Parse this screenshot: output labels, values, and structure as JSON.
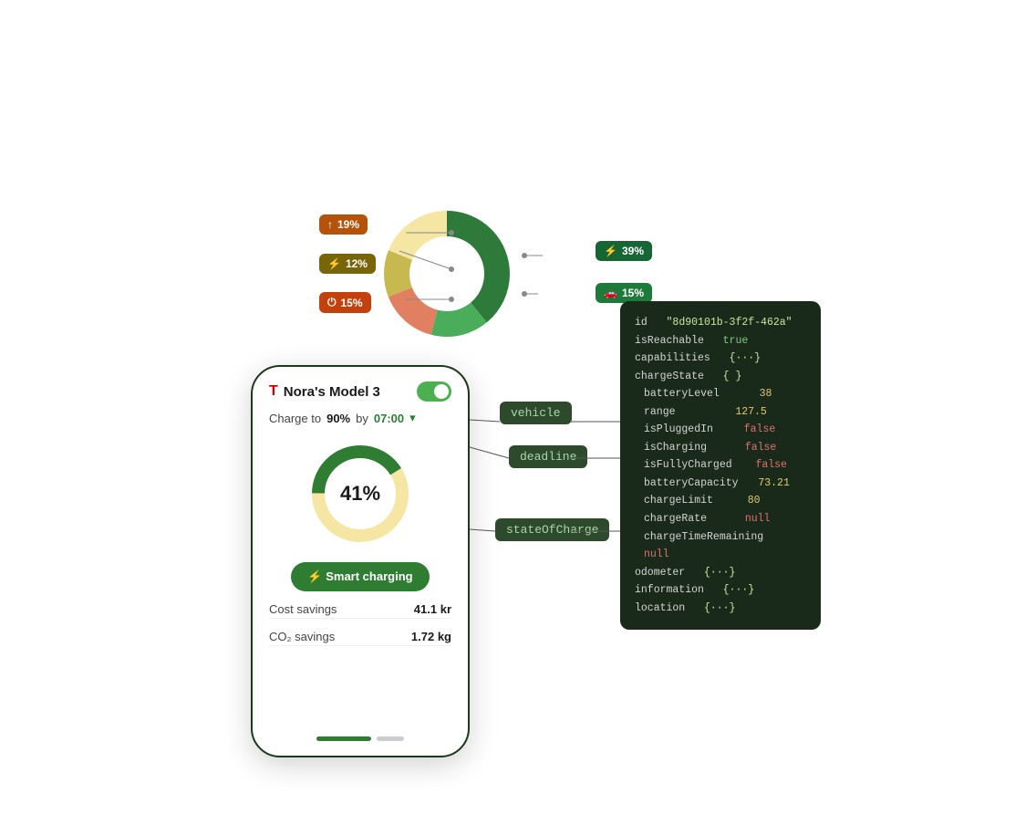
{
  "donut": {
    "segments": [
      {
        "label": "19%",
        "color": "#f5e6a3",
        "value": 19,
        "icon": "↑"
      },
      {
        "label": "12%",
        "color": "#c8b850",
        "value": 12,
        "icon": "⚡"
      },
      {
        "label": "15%",
        "color": "#e8a080",
        "value": 15,
        "icon": "⏻"
      },
      {
        "label": "39%",
        "color": "#2d7a3a",
        "value": 39,
        "icon": "⚡"
      },
      {
        "label": "15%",
        "color": "#4aad5a",
        "value": 15,
        "icon": "🚗"
      }
    ]
  },
  "phone": {
    "title": "Nora's Model 3",
    "charge_to": "Charge to",
    "charge_pct": "90%",
    "charge_by": "by",
    "charge_time": "07:00",
    "battery_pct": "41%",
    "smart_btn": "⚡ Smart charging",
    "cost_label": "Cost savings",
    "cost_val": "41.1 kr",
    "co2_label": "CO₂ savings",
    "co2_val": "1.72 kg"
  },
  "flow": {
    "vehicle_label": "vehicle",
    "deadline_label": "deadline",
    "stateOfCharge_label": "stateOfCharge"
  },
  "json_panel": {
    "id_key": "id",
    "id_val": "\"8d90101b-3f2f-462a\"",
    "isReachable_key": "isReachable",
    "isReachable_val": "true",
    "capabilities_key": "capabilities",
    "capabilities_val": "{···}",
    "chargeState_key": "chargeState",
    "chargeState_val": "{ }",
    "batteryLevel_key": "batteryLevel",
    "batteryLevel_val": "38",
    "range_key": "range",
    "range_val": "127.5",
    "isPluggedIn_key": "isPluggedIn",
    "isPluggedIn_val": "false",
    "isCharging_key": "isCharging",
    "isCharging_val": "false",
    "isFullyCharged_key": "isFullyCharged",
    "isFullyCharged_val": "false",
    "batteryCapacity_key": "batteryCapacity",
    "batteryCapacity_val": "73.21",
    "chargeLimit_key": "chargeLimit",
    "chargeLimit_val": "80",
    "chargeRate_key": "chargeRate",
    "chargeRate_val": "null",
    "chargeTimeRemaining_key": "chargeTimeRemaining",
    "chargeTimeRemaining_val": "null",
    "odometer_key": "odometer",
    "odometer_val": "{···}",
    "information_key": "information",
    "information_val": "{···}",
    "location_key": "location",
    "location_val": "{···}"
  }
}
